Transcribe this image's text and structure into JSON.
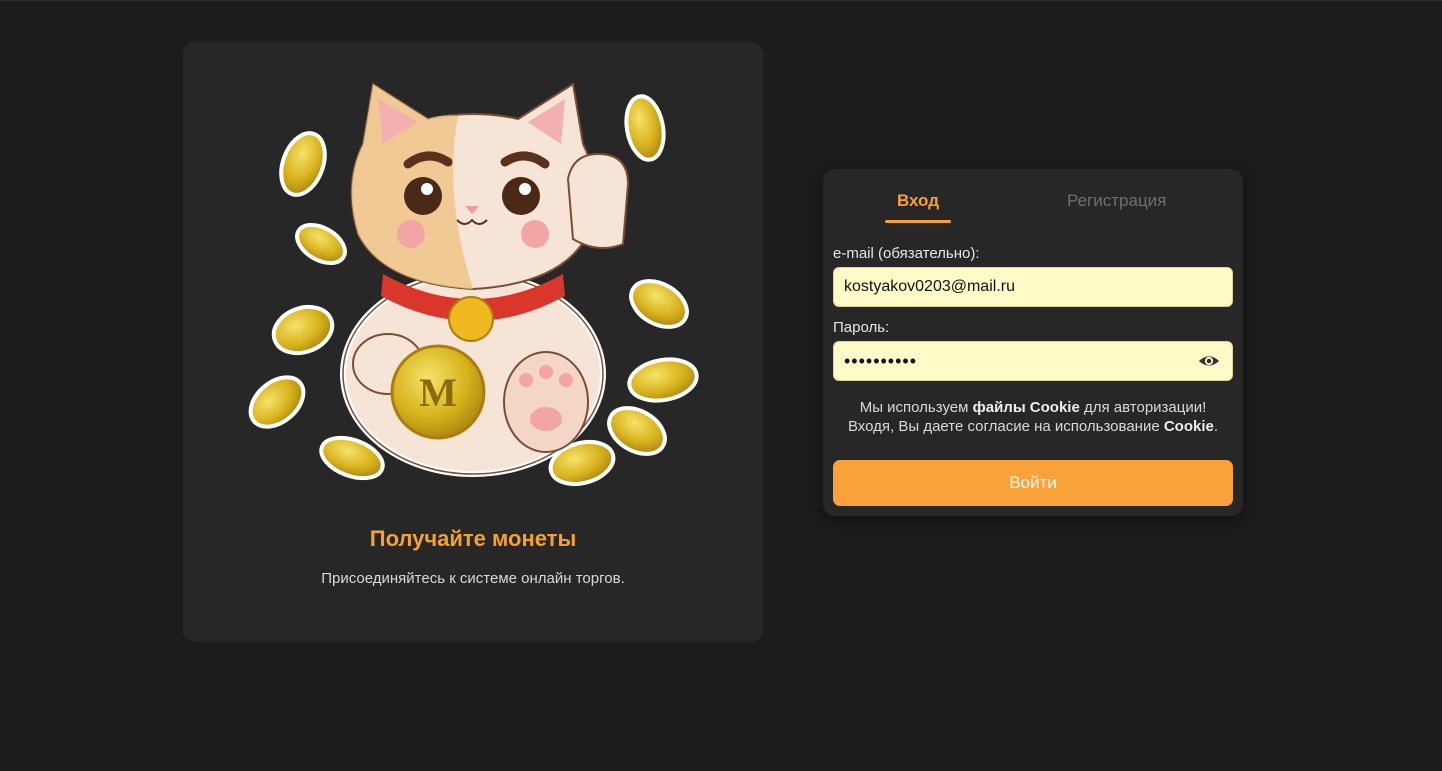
{
  "promo": {
    "title": "Получайте монеты",
    "subtitle": "Присоединяйтесь к системе онлайн торгов."
  },
  "auth": {
    "tabs": {
      "login": "Вход",
      "register": "Регистрация"
    },
    "email": {
      "label": "e-mail (обязательно):",
      "value": "kostyakov0203@mail.ru"
    },
    "password": {
      "label": "Пароль:",
      "value": "••••••••••"
    },
    "cookie_note": {
      "line1_before": "Мы используем ",
      "line1_bold": "файлы Cookie",
      "line1_after": " для авторизации!",
      "line2_before": "Входя, Вы даете согласие на использование ",
      "line2_bold": "Cookie",
      "line2_after": "."
    },
    "submit_label": "Войти"
  },
  "colors": {
    "accent": "#f7a032",
    "button": "#f9a23a",
    "input_bg": "#fefbc8",
    "card_bg": "#272727",
    "page_bg": "#1c1c1c"
  },
  "icons": {
    "illustration": "lucky-cat-illustration",
    "password_toggle": "eye-icon"
  }
}
